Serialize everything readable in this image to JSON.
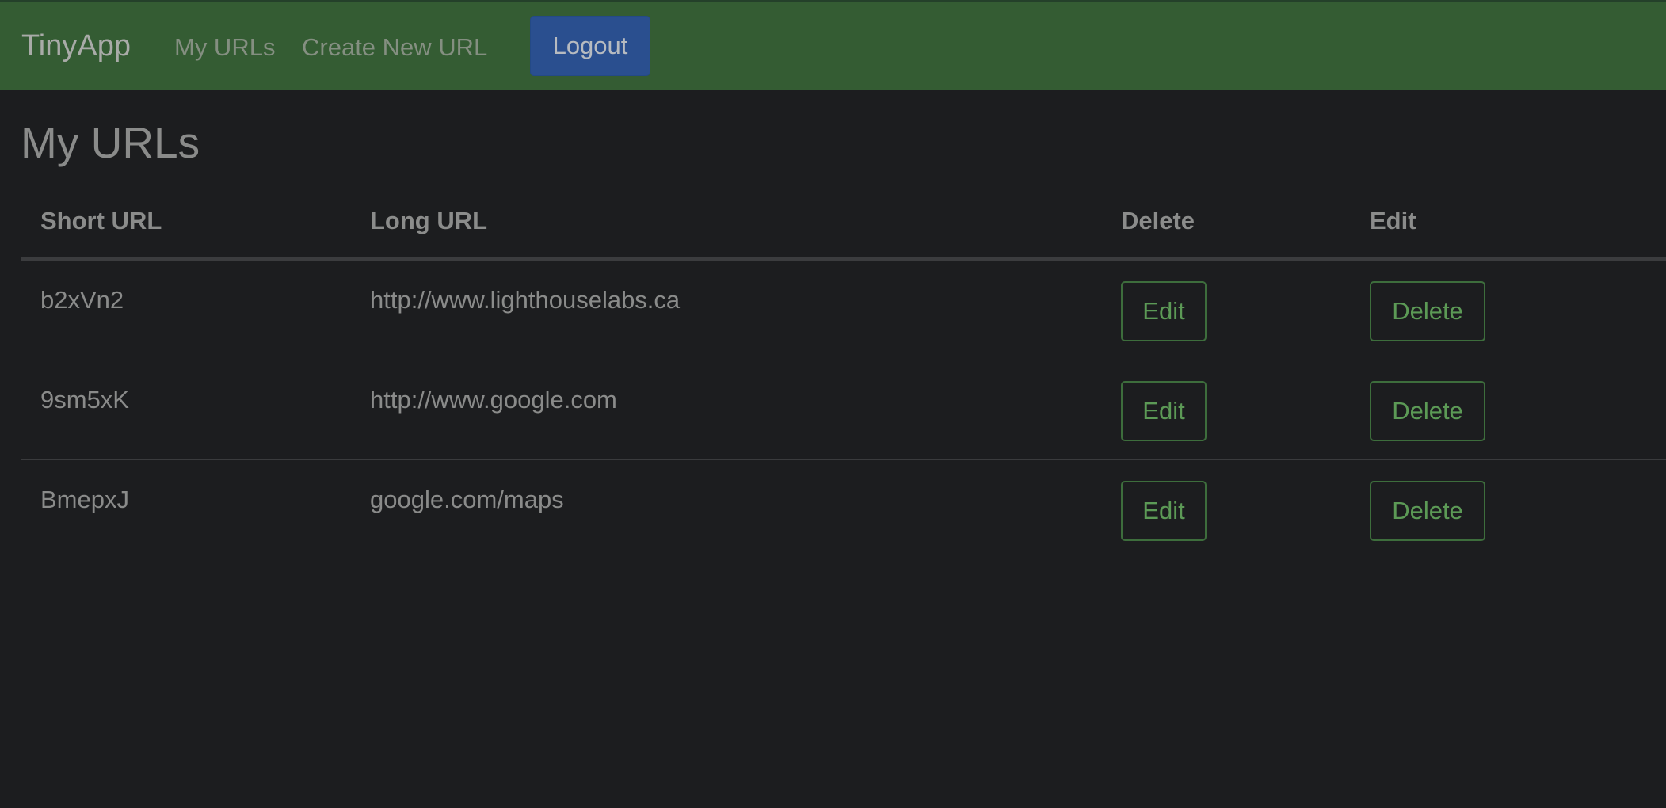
{
  "navbar": {
    "brand": "TinyApp",
    "links": [
      "My URLs",
      "Create New URL"
    ],
    "logout_label": "Logout"
  },
  "main": {
    "title": "My URLs",
    "table": {
      "headers": [
        "Short URL",
        "Long URL",
        "Delete",
        "Edit"
      ],
      "rows": [
        {
          "short_url": "b2xVn2",
          "long_url": "http://www.lighthouselabs.ca",
          "edit_label": "Edit",
          "delete_label": "Delete"
        },
        {
          "short_url": "9sm5xK",
          "long_url": "http://www.google.com",
          "edit_label": "Edit",
          "delete_label": "Delete"
        },
        {
          "short_url": "BmepxJ",
          "long_url": "google.com/maps",
          "edit_label": "Edit",
          "delete_label": "Delete"
        }
      ]
    }
  },
  "colors": {
    "navbar_bg": "#345c33",
    "page_bg": "#1c1d1f",
    "logout_bg": "#2a4f8f",
    "button_outline": "#3d6d3c",
    "button_text": "#5c9a56"
  }
}
